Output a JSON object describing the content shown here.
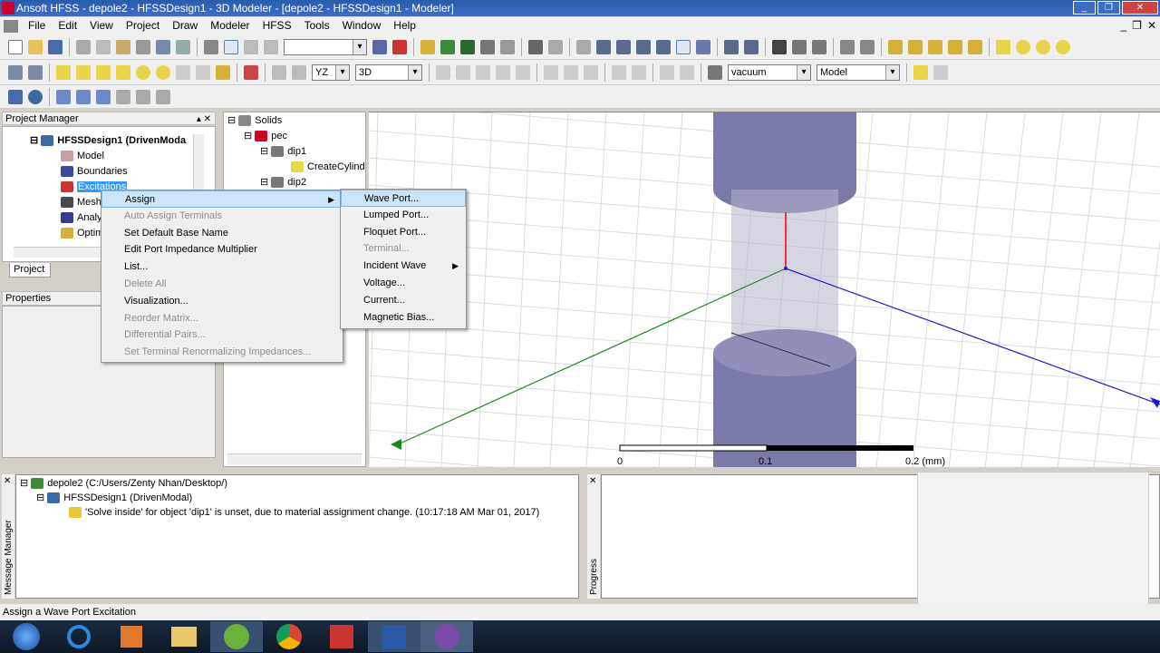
{
  "window": {
    "title": "Ansoft HFSS - depole2 - HFSSDesign1 - 3D Modeler - [depole2 - HFSSDesign1 - Modeler]"
  },
  "menubar": {
    "items": [
      "File",
      "Edit",
      "View",
      "Project",
      "Draw",
      "Modeler",
      "HFSS",
      "Tools",
      "Window",
      "Help"
    ]
  },
  "toolbar": {
    "plane_value": "YZ",
    "view_value": "3D",
    "material_value": "vacuum",
    "model_value": "Model"
  },
  "project_manager": {
    "title": "Project Manager",
    "tab": "Project",
    "properties_title": "Properties",
    "tree": [
      {
        "label": "HFSSDesign1 (DrivenModa"
      },
      {
        "label": "Model"
      },
      {
        "label": "Boundaries"
      },
      {
        "label": "Excitations"
      },
      {
        "label": "Mesh"
      },
      {
        "label": "Analy"
      },
      {
        "label": "Optim"
      }
    ]
  },
  "model_tree": {
    "items": [
      {
        "label": "Solids"
      },
      {
        "label": "pec"
      },
      {
        "label": "dip1"
      },
      {
        "label": "CreateCylind"
      },
      {
        "label": "dip2"
      }
    ]
  },
  "context_menu": {
    "items": [
      {
        "label": "Assign",
        "disabled": false,
        "selected": true,
        "submenu": true
      },
      {
        "label": "Auto Assign Terminals",
        "disabled": true
      },
      {
        "label": "Set Default Base Name",
        "disabled": false
      },
      {
        "label": "Edit Port Impedance Multiplier",
        "disabled": false
      },
      {
        "label": "List...",
        "disabled": false
      },
      {
        "label": "Delete All",
        "disabled": true
      },
      {
        "label": "Visualization...",
        "disabled": false
      },
      {
        "label": "Reorder Matrix...",
        "disabled": true
      },
      {
        "label": "Differential Pairs...",
        "disabled": true
      },
      {
        "label": "Set Terminal Renormalizing Impedances...",
        "disabled": true
      }
    ]
  },
  "submenu": {
    "items": [
      {
        "label": "Wave Port...",
        "disabled": false,
        "selected": true
      },
      {
        "label": "Lumped Port...",
        "disabled": false
      },
      {
        "label": "Floquet Port...",
        "disabled": false
      },
      {
        "label": "Terminal...",
        "disabled": true
      },
      {
        "label": "Incident Wave",
        "disabled": false,
        "submenu": true
      },
      {
        "label": "Voltage...",
        "disabled": false
      },
      {
        "label": "Current...",
        "disabled": false
      },
      {
        "label": "Magnetic Bias...",
        "disabled": false
      }
    ]
  },
  "scale": {
    "labels": [
      "0",
      "0.1",
      "0.2 (mm)"
    ]
  },
  "message_manager": {
    "title": "Message Manager",
    "project": "depole2 (C:/Users/Zenty Nhan/Desktop/)",
    "design": "HFSSDesign1 (DrivenModal)",
    "warning": "'Solve inside' for object 'dip1' is unset, due to material assignment change. (10:17:18 AM  Mar 01, 2017)"
  },
  "progress": {
    "title": "Progress"
  },
  "status": {
    "text": "Assign a Wave Port Excitation"
  }
}
